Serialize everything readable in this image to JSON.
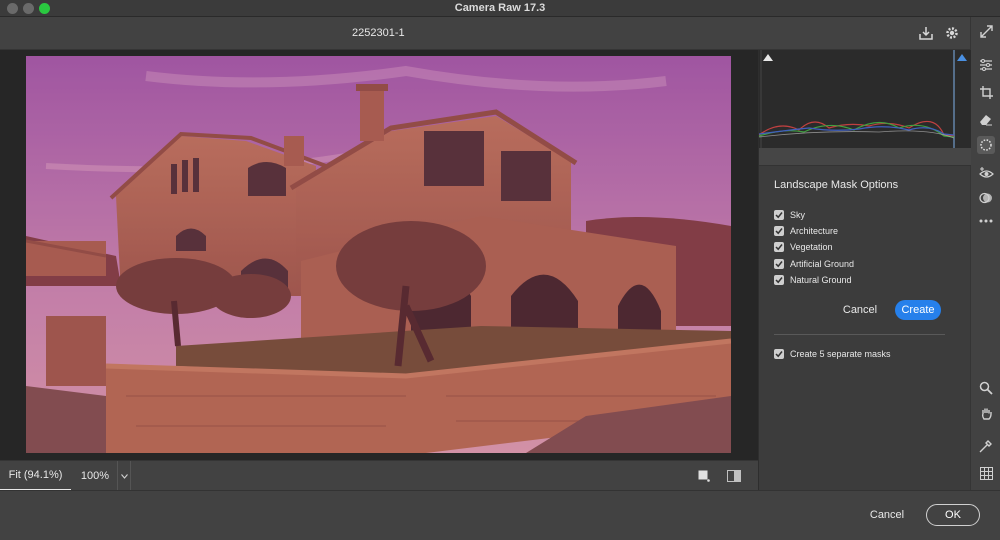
{
  "window": {
    "title": "Camera Raw 17.3"
  },
  "file": {
    "name": "2252301-1"
  },
  "colors": {
    "accent": "#2680eb",
    "mask_overlay": "#c05a70"
  },
  "top_icons": [
    "save-icon",
    "gear-icon",
    "expand-icon"
  ],
  "rail_icons": [
    "edit-sliders-icon",
    "crop-icon",
    "eraser-icon",
    "masking-icon",
    "red-eye-icon",
    "presets-icon",
    "more-icon",
    "zoom-icon",
    "hand-icon",
    "sampler-icon",
    "grid-icon"
  ],
  "view": {
    "fit_label": "Fit (94.1%)",
    "zoom_label": "100%"
  },
  "mask_options": {
    "title": "Landscape Mask Options",
    "options": [
      {
        "label": "Sky",
        "checked": true
      },
      {
        "label": "Architecture",
        "checked": true
      },
      {
        "label": "Vegetation",
        "checked": true
      },
      {
        "label": "Artificial Ground",
        "checked": true
      },
      {
        "label": "Natural Ground",
        "checked": true
      }
    ],
    "cancel_label": "Cancel",
    "create_label": "Create",
    "separate_label": "Create 5 separate masks",
    "separate_checked": true
  },
  "footer": {
    "cancel_label": "Cancel",
    "ok_label": "OK"
  }
}
